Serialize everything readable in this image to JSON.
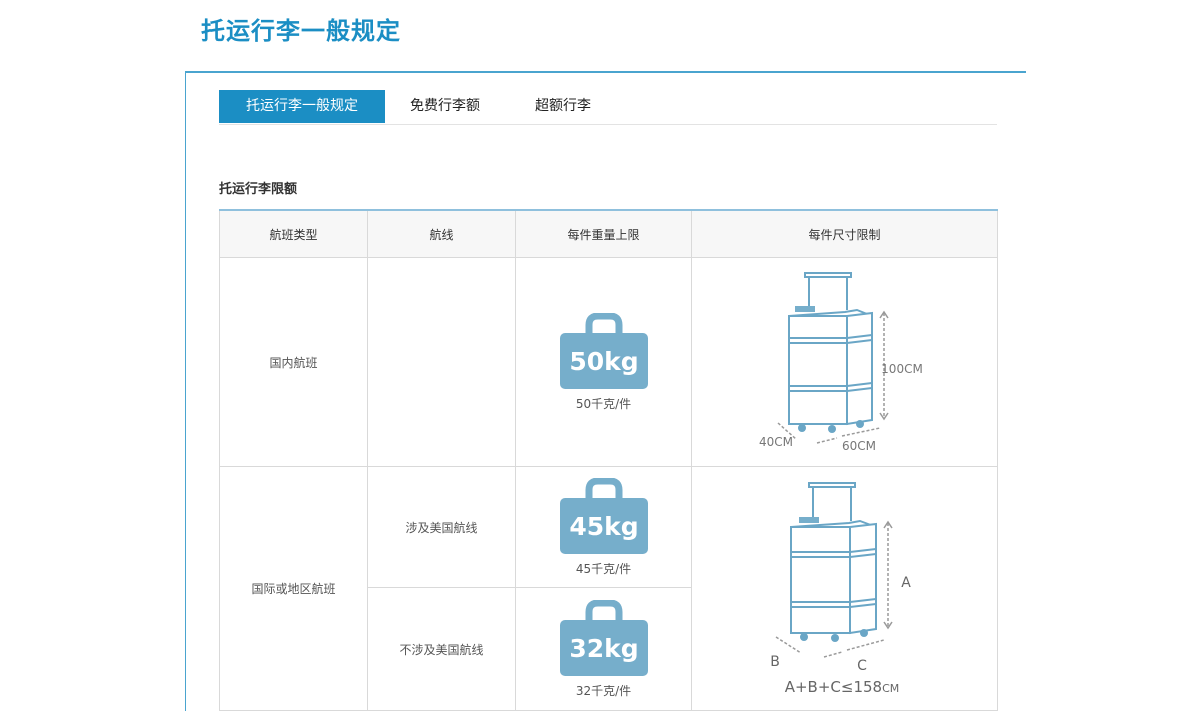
{
  "page": {
    "title": "托运行李一般规定"
  },
  "tabs": [
    {
      "label": "托运行李一般规定",
      "active": true
    },
    {
      "label": "免费行李额",
      "active": false
    },
    {
      "label": "超额行李",
      "active": false
    }
  ],
  "section": {
    "title": "托运行李限额"
  },
  "table": {
    "headers": [
      "航班类型",
      "航线",
      "每件重量上限",
      "每件尺寸限制"
    ],
    "domestic": {
      "flight_type": "国内航班",
      "route": "",
      "weight_badge": "50kg",
      "weight_caption": "50千克/件",
      "dims": {
        "height": "100CM",
        "depth": "40CM",
        "width": "60CM"
      }
    },
    "international": {
      "flight_type": "国际或地区航班",
      "routes": [
        {
          "route": "涉及美国航线",
          "weight_badge": "45kg",
          "weight_caption": "45千克/件"
        },
        {
          "route": "不涉及美国航线",
          "weight_badge": "32kg",
          "weight_caption": "32千克/件"
        }
      ],
      "dims": {
        "a": "A",
        "b": "B",
        "c": "C",
        "formula": "A+B+C≤158",
        "unit": "CM"
      }
    }
  },
  "colors": {
    "accent": "#1b8ec4",
    "bag_fill": "#76aecb",
    "suitcase_stroke": "#6aa6c6",
    "suitcase_fill": "#ffffff",
    "dim_line": "#9a9a9a"
  }
}
